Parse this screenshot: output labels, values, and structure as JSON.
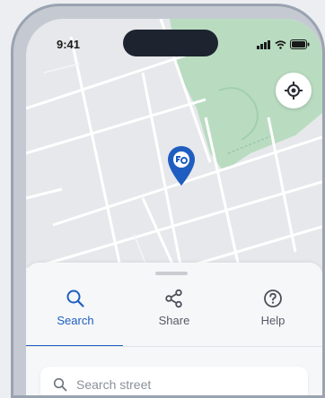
{
  "status_bar": {
    "time": "9:41"
  },
  "colors": {
    "accent": "#1f5ec0",
    "map_land": "#e7e8eb",
    "map_park": "#b9dcc1",
    "map_road": "#ffffff",
    "pin": "#1f5ec0"
  },
  "icons": {
    "locate": "crosshair-icon",
    "pin": "map-pin-icon",
    "search": "search-icon",
    "share": "share-icon",
    "help": "help-icon"
  },
  "tabs": [
    {
      "label": "Search",
      "icon": "search-icon",
      "active": true
    },
    {
      "label": "Share",
      "icon": "share-icon",
      "active": false
    },
    {
      "label": "Help",
      "icon": "help-icon",
      "active": false
    }
  ],
  "search": {
    "placeholder": "Search street"
  }
}
